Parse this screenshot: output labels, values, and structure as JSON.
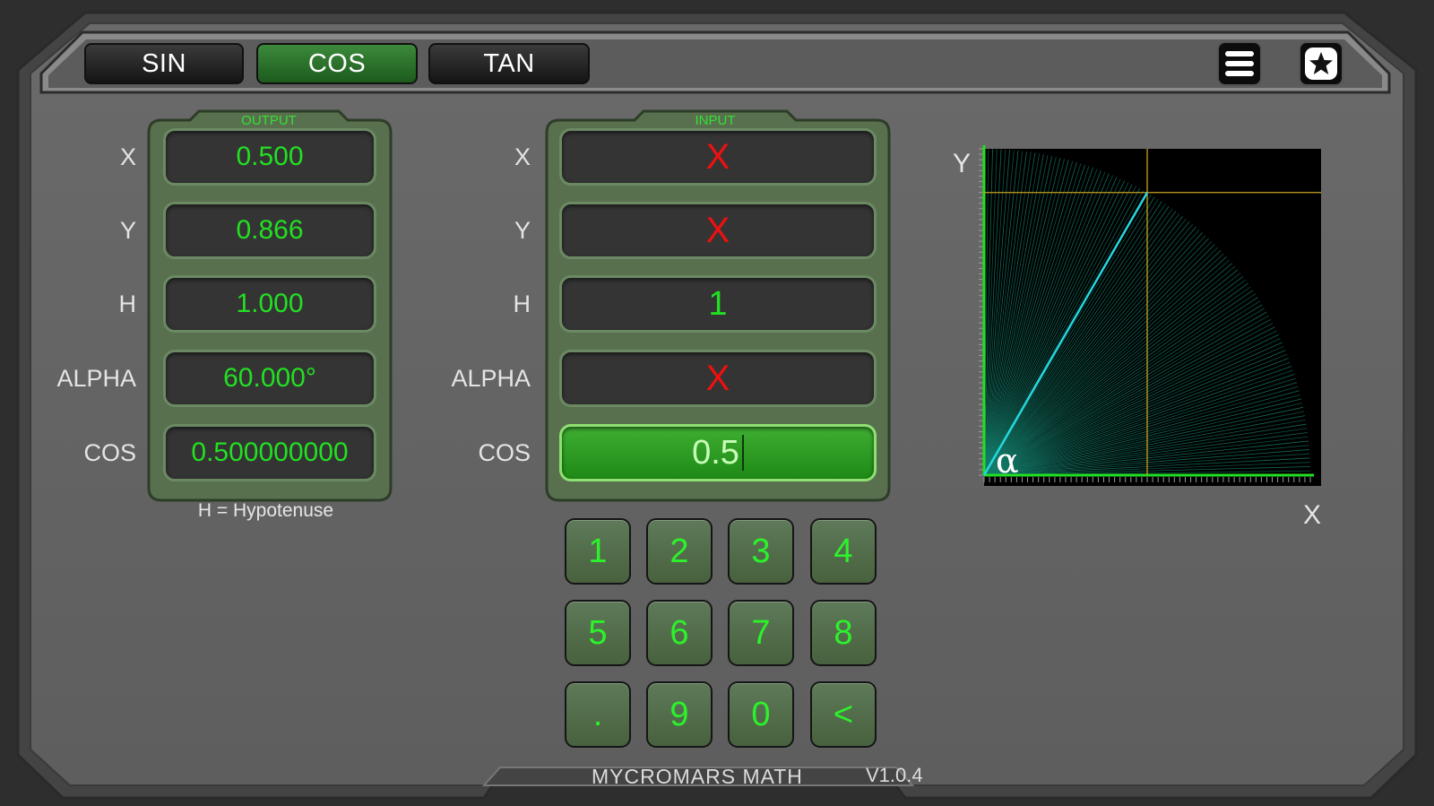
{
  "tabs": [
    {
      "label": "SIN",
      "active": false
    },
    {
      "label": "COS",
      "active": true
    },
    {
      "label": "TAN",
      "active": false
    }
  ],
  "toolbar": {
    "menu_icon": "hamburger-menu-icon",
    "favorite_icon": "star-icon"
  },
  "output": {
    "title": "OUTPUT",
    "rows": [
      {
        "label": "X",
        "value": "0.500"
      },
      {
        "label": "Y",
        "value": "0.866"
      },
      {
        "label": "H",
        "value": "1.000"
      },
      {
        "label": "ALPHA",
        "value": "60.000°"
      },
      {
        "label": "COS",
        "value": "0.500000000"
      }
    ],
    "note": "H = Hypotenuse"
  },
  "input": {
    "title": "INPUT",
    "rows": [
      {
        "label": "X",
        "value": "X"
      },
      {
        "label": "Y",
        "value": "X"
      },
      {
        "label": "H",
        "value": "1"
      },
      {
        "label": "ALPHA",
        "value": "X"
      },
      {
        "label": "COS",
        "value": "0.5"
      }
    ]
  },
  "keypad": {
    "keys": [
      "1",
      "2",
      "3",
      "4",
      "5",
      "6",
      "7",
      "8",
      ".",
      "9",
      "0",
      "<"
    ]
  },
  "graph": {
    "y_label": "Y",
    "x_label": "X",
    "alpha_label": "α",
    "angle_degrees": 60,
    "cos_value": 0.5,
    "sin_value": 0.866
  },
  "footer": {
    "title": "MYCROMARS MATH",
    "version": "V1.0.4"
  },
  "colors": {
    "accent_green": "#22e022",
    "invalid_red": "#ef1010",
    "graph_cyan": "#25d7e0",
    "graph_guide": "#c8a020"
  }
}
